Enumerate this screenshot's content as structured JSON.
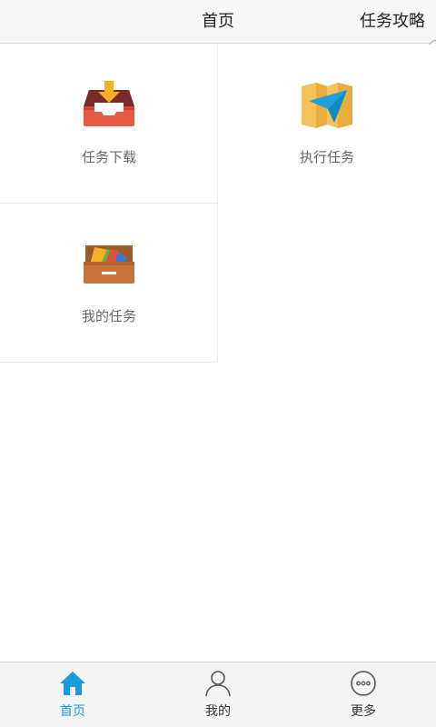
{
  "header": {
    "title": "首页",
    "action": "任务攻略"
  },
  "grid": {
    "items": [
      {
        "label": "任务下载",
        "icon": "download-tray-icon"
      },
      {
        "label": "执行任务",
        "icon": "map-navigation-icon"
      },
      {
        "label": "我的任务",
        "icon": "drawer-files-icon"
      }
    ]
  },
  "tabbar": {
    "items": [
      {
        "label": "首页",
        "icon": "home-icon",
        "active": true
      },
      {
        "label": "我的",
        "icon": "user-icon",
        "active": false
      },
      {
        "label": "更多",
        "icon": "more-icon",
        "active": false
      }
    ]
  },
  "colors": {
    "accent": "#1a9bd7",
    "header_bg": "#f7f7f7",
    "tabbar_bg": "#f5f5f5",
    "label": "#666666"
  }
}
